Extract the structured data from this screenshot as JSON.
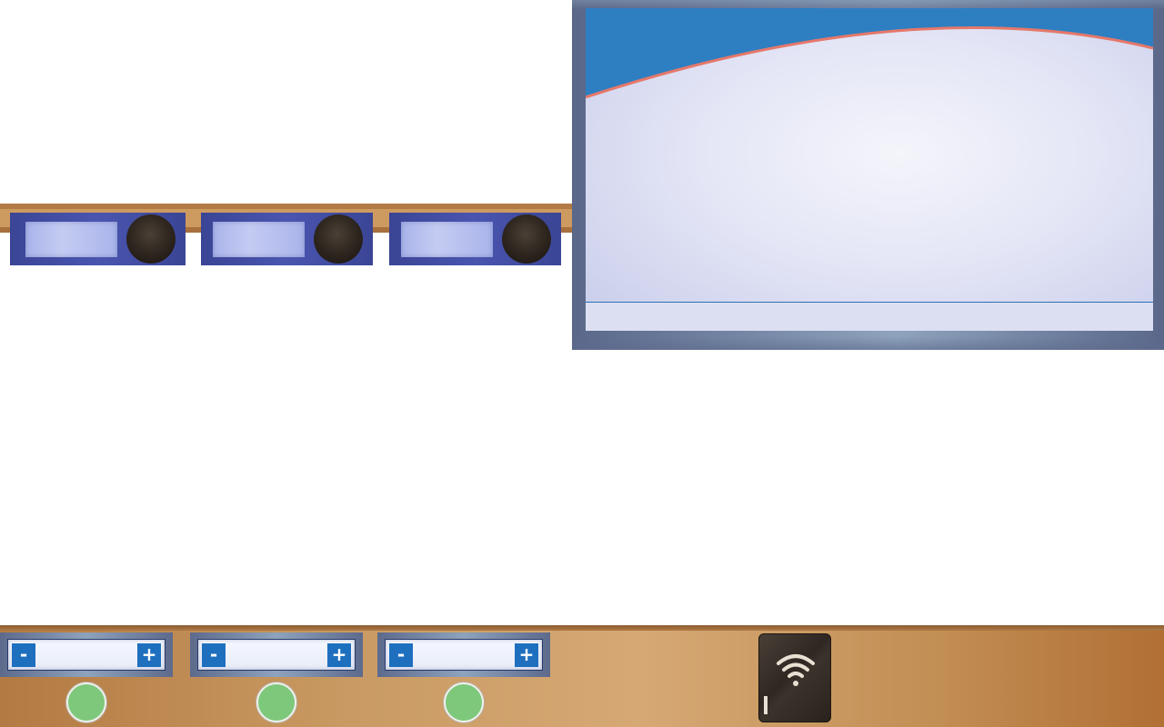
{
  "app": {
    "title": ""
  },
  "slots": [
    {
      "id": "slot-1"
    },
    {
      "id": "slot-2"
    },
    {
      "id": "slot-3"
    }
  ],
  "display": {
    "content": ""
  },
  "steppers": [
    {
      "minus_label": "-",
      "plus_label": "+",
      "value": ""
    },
    {
      "minus_label": "-",
      "plus_label": "+",
      "value": ""
    },
    {
      "minus_label": "-",
      "plus_label": "+",
      "value": ""
    }
  ],
  "indicators": [
    {
      "status": "on",
      "color": "#7ec87c"
    },
    {
      "status": "on",
      "color": "#7ec87c"
    },
    {
      "status": "on",
      "color": "#7ec87c"
    }
  ],
  "wifi_button": {
    "icon": "wifi-icon"
  },
  "colors": {
    "slot_blue": "#4a55b0",
    "stepper_button_blue": "#1f6fbf",
    "screen_header_blue": "#2d7fc2",
    "screen_arc_red": "#e5786a",
    "indicator_green": "#7ec87c",
    "wood": "#c99a63"
  }
}
